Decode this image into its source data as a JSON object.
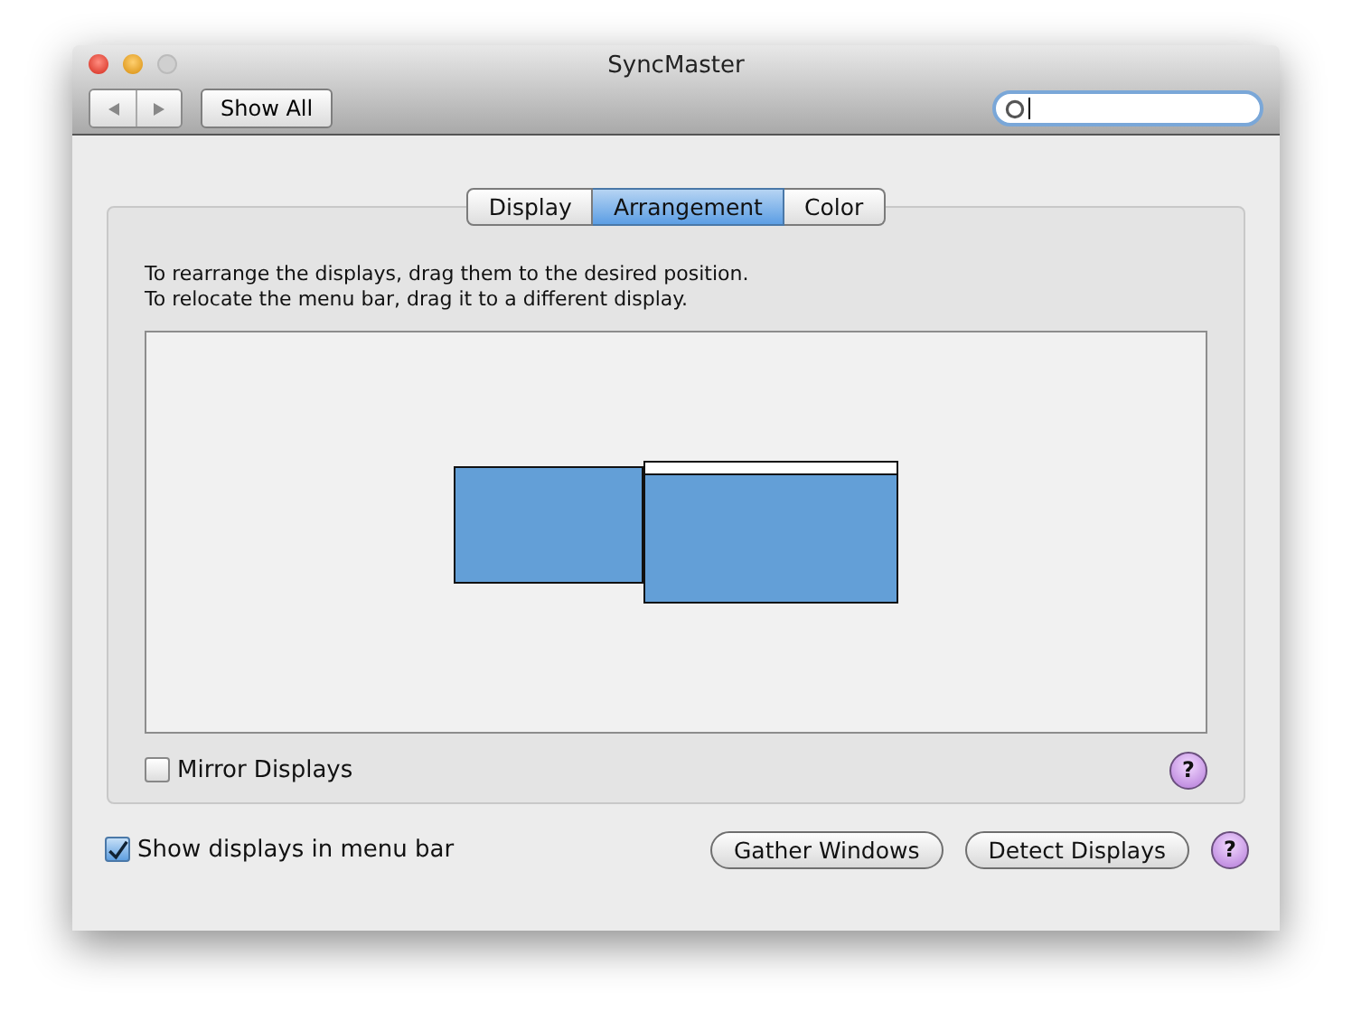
{
  "window": {
    "title": "SyncMaster",
    "show_all": "Show All"
  },
  "tabs": [
    {
      "label": "Display",
      "selected": false
    },
    {
      "label": "Arrangement",
      "selected": true
    },
    {
      "label": "Color",
      "selected": false
    }
  ],
  "instructions": [
    "To rearrange the displays, drag them to the desired position.",
    "To relocate the menu bar, drag it to a different display."
  ],
  "displays": [
    {
      "has_menu_bar": false
    },
    {
      "has_menu_bar": true
    }
  ],
  "mirror": {
    "label": "Mirror Displays",
    "checked": false,
    "help": "?"
  },
  "footer": {
    "show_in_menu_bar": {
      "label": "Show displays in menu bar",
      "checked": true
    },
    "buttons": [
      "Gather Windows",
      "Detect Displays"
    ],
    "help": "?"
  }
}
